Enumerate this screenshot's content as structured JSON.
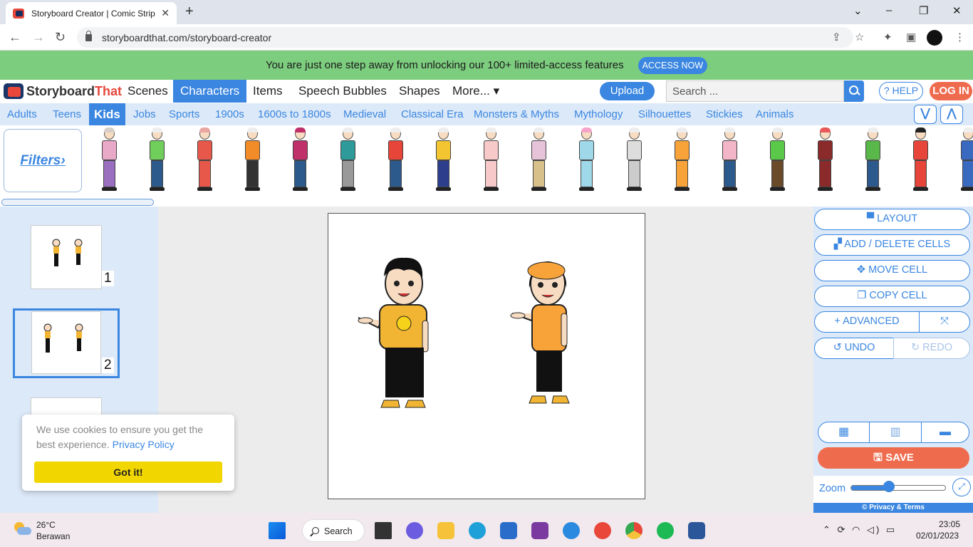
{
  "browser": {
    "tab_title": "Storyboard Creator | Comic Strip",
    "tab_close": "✕",
    "new_tab": "+",
    "url": "storyboardthat.com/storyboard-creator",
    "window_controls": [
      "⌄",
      "–",
      "❐",
      "✕"
    ]
  },
  "banner": {
    "text": "You are just one step away from unlocking our 100+ limited-access features",
    "button": "ACCESS NOW"
  },
  "header": {
    "logo_story": "Storyboard",
    "logo_that": "That",
    "nav": [
      "Scenes",
      "Characters",
      "Items",
      "Speech Bubbles",
      "Shapes",
      "More... ▾"
    ],
    "active_nav": "Characters",
    "upload": "Upload",
    "search_placeholder": "Search ...",
    "help": "? HELP",
    "login": "LOG IN"
  },
  "categories": {
    "items": [
      "Adults",
      "Teens",
      "Kids",
      "Jobs",
      "Sports",
      "1900s",
      "1600s to 1800s",
      "Medieval",
      "Classical Era",
      "Monsters & Myths",
      "Mythology",
      "Silhouettes",
      "Stickies",
      "Animals"
    ],
    "active": "Kids",
    "collapse": "⋁",
    "expand": "⋀"
  },
  "character_strip": {
    "filters": "Filters›",
    "kids": [
      {
        "hair": "#d6cfc8",
        "shirt": "#e8a9c9",
        "pants": "#9b6fc0"
      },
      {
        "hair": "#eee",
        "shirt": "#6fcf5a",
        "pants": "#2d5a8c"
      },
      {
        "hair": "#e9a6a2",
        "shirt": "#e8584a",
        "pants": "#e8584a"
      },
      {
        "hair": "#eee",
        "shirt": "#f28c28",
        "pants": "#333"
      },
      {
        "hair": "#c0306a",
        "shirt": "#c0306a",
        "pants": "#2d5a8c"
      },
      {
        "hair": "#eee",
        "shirt": "#2e9a9a",
        "pants": "#999"
      },
      {
        "hair": "#eee",
        "shirt": "#e8453a",
        "pants": "#2d5a8c"
      },
      {
        "hair": "#eee",
        "shirt": "#f2c531",
        "pants": "#2d3f8c"
      },
      {
        "hair": "#eee",
        "shirt": "#f7c9c9",
        "pants": "#f7c9c9"
      },
      {
        "hair": "#eee",
        "shirt": "#e6c3d8",
        "pants": "#d8c08a"
      },
      {
        "hair": "#f5a3c8",
        "shirt": "#9fd8e8",
        "pants": "#9fd8e8"
      },
      {
        "hair": "#eee",
        "shirt": "#ddd",
        "pants": "#ccc"
      },
      {
        "hair": "#eee",
        "shirt": "#f7a33a",
        "pants": "#f7a33a"
      },
      {
        "hair": "#eee",
        "shirt": "#f2b6c8",
        "pants": "#2d5a8c"
      },
      {
        "hair": "#eee",
        "shirt": "#5ac94a",
        "pants": "#6b4a2a"
      },
      {
        "hair": "#e85a5a",
        "shirt": "#8a2a2a",
        "pants": "#8a2a2a"
      },
      {
        "hair": "#eee",
        "shirt": "#5ab84a",
        "pants": "#2d5a8c"
      },
      {
        "hair": "#222",
        "shirt": "#e8453a",
        "pants": "#e8453a"
      },
      {
        "hair": "#eee",
        "shirt": "#3a6abf",
        "pants": "#3a6abf"
      }
    ]
  },
  "cells": [
    {
      "num": "1"
    },
    {
      "num": "2"
    }
  ],
  "right_panel": {
    "layout": "▀ LAYOUT",
    "add_delete": "▞ ADD / DELETE CELLS",
    "move": "✥ MOVE CELL",
    "copy": "❐ COPY CELL",
    "advanced": "+ ADVANCED",
    "fullscreen": "⤧",
    "undo": "↺ UNDO",
    "redo": "↻ REDO",
    "view_modes": [
      "▦",
      "▥",
      "▬"
    ],
    "save": "🖫 SAVE",
    "zoom_label": "Zoom",
    "zoom_level": 0.4,
    "zoom_expand": "⤢",
    "privacy": "© Privacy & Terms"
  },
  "cookie": {
    "message": "We use cookies to ensure you get the best experience.",
    "link": "Privacy Policy",
    "button": "Got it!"
  },
  "taskbar": {
    "temp": "26°C",
    "weather": "Berawan",
    "search": "Search",
    "time": "23:05",
    "date": "02/01/2023",
    "tray": "⌃ ⟳ ◠ ◁) ▭"
  },
  "colors": {
    "accent": "#3a86e0",
    "banner": "#7dcd7f",
    "panel": "#dce9f8",
    "save": "#ef6b4e"
  }
}
